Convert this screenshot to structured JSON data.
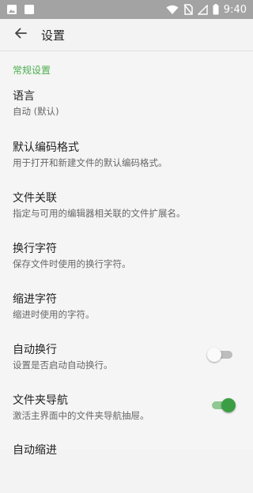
{
  "status_bar": {
    "time": "9:40",
    "icons": [
      "image-icon",
      "square-icon",
      "wifi-icon",
      "no-sim-icon",
      "signal-icon",
      "battery-icon"
    ]
  },
  "app_bar": {
    "title": "设置",
    "back_icon": "arrow-back-icon"
  },
  "section": {
    "header": "常规设置"
  },
  "settings": [
    {
      "title": "语言",
      "summary": "自动 (默认)"
    },
    {
      "title": "默认编码格式",
      "summary": "用于打开和新建文件的默认编码格式。"
    },
    {
      "title": "文件关联",
      "summary": "指定与可用的编辑器相关联的文件扩展名。"
    },
    {
      "title": "换行字符",
      "summary": "保存文件时使用的换行字符。"
    },
    {
      "title": "缩进字符",
      "summary": "缩进时使用的字符。"
    },
    {
      "title": "自动换行",
      "summary": "设置是否启动自动换行。",
      "switch": false
    },
    {
      "title": "文件夹导航",
      "summary": "激活主界面中的文件夹导航抽屉。",
      "switch": true
    },
    {
      "title": "自动缩进",
      "summary": ""
    }
  ],
  "colors": {
    "accent": "#4caf50",
    "switch_on": "#3b9e44",
    "status_bar": "#a3a3a3"
  }
}
